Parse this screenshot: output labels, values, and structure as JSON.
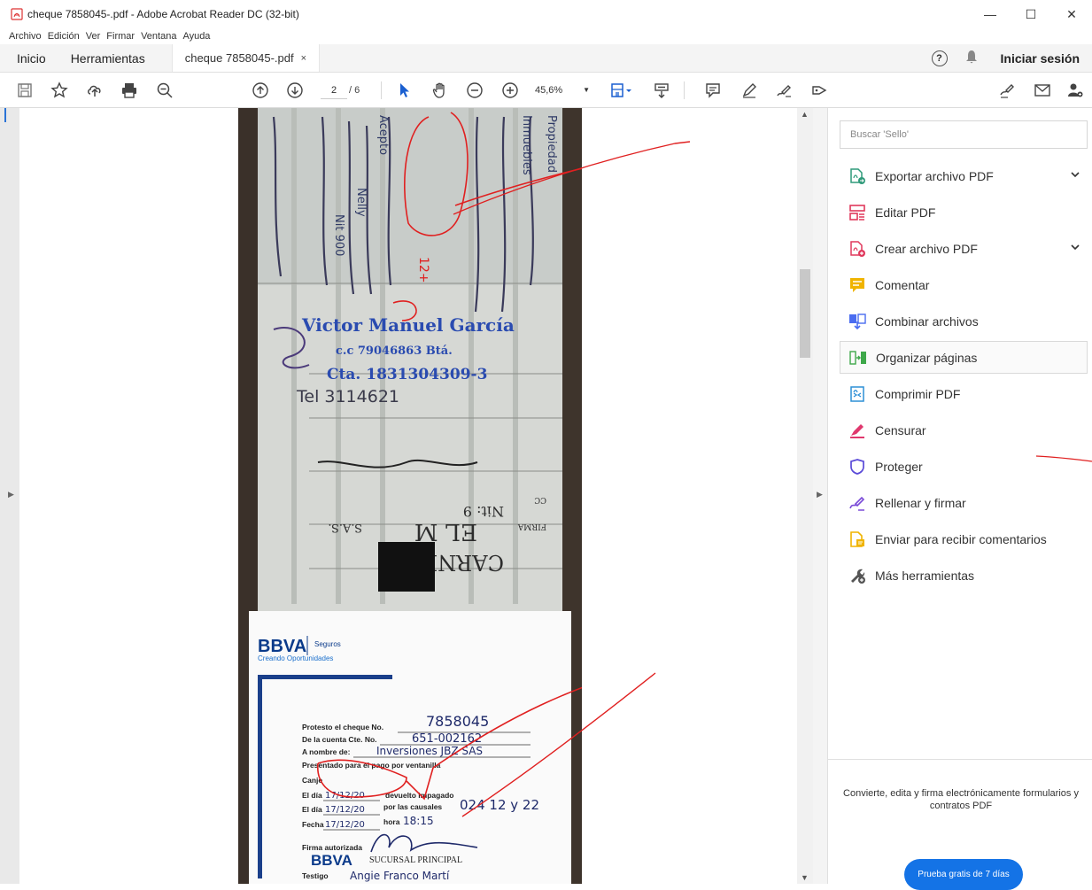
{
  "window": {
    "title": "cheque 7858045-.pdf - Adobe Acrobat Reader DC (32-bit)",
    "controls": {
      "minimize": "—",
      "maximize": "☐",
      "close": "✕"
    }
  },
  "menu": [
    "Archivo",
    "Edición",
    "Ver",
    "Firmar",
    "Ventana",
    "Ayuda"
  ],
  "tabs": {
    "home": "Inicio",
    "tools": "Herramientas",
    "document": "cheque 7858045-.pdf",
    "close": "×"
  },
  "header_right": {
    "help": "?",
    "signin": "Iniciar sesión"
  },
  "toolbar": {
    "current_page": "2",
    "total_pages": "/ 6",
    "zoom": "45,6%",
    "zoom_caret": "▼"
  },
  "panel": {
    "search_placeholder": "Buscar 'Sello'",
    "tools": [
      {
        "label": "Exportar archivo PDF",
        "icon": "export-pdf-icon",
        "color": "#2f9a7a",
        "expandable": true
      },
      {
        "label": "Editar PDF",
        "icon": "edit-pdf-icon",
        "color": "#e0385c"
      },
      {
        "label": "Crear archivo PDF",
        "icon": "create-pdf-icon",
        "color": "#e0385c",
        "expandable": true
      },
      {
        "label": "Comentar",
        "icon": "comment-icon",
        "color": "#f0b400"
      },
      {
        "label": "Combinar archivos",
        "icon": "combine-files-icon",
        "color": "#4a6cf0"
      },
      {
        "label": "Organizar páginas",
        "icon": "organize-pages-icon",
        "color": "#3ea84a",
        "selected": true
      },
      {
        "label": "Comprimir PDF",
        "icon": "compress-pdf-icon",
        "color": "#2d8fd6"
      },
      {
        "label": "Censurar",
        "icon": "redact-icon",
        "color": "#e0386e"
      },
      {
        "label": "Proteger",
        "icon": "protect-icon",
        "color": "#5a4ad8"
      },
      {
        "label": "Rellenar y firmar",
        "icon": "fill-sign-icon",
        "color": "#7a4ad8"
      },
      {
        "label": "Enviar para recibir comentarios",
        "icon": "send-review-icon",
        "color": "#f0b400"
      },
      {
        "label": "Más herramientas",
        "icon": "more-tools-icon",
        "color": "#555555"
      }
    ],
    "promo_text": "Convierte, edita y firma electrónicamente formularios y contratos PDF",
    "promo_button": "Prueba gratis de 7 días"
  },
  "document": {
    "handwritten_top": [
      "Propiedad",
      "Inmuebles",
      "Acepto",
      "Nelly",
      "Nit 900"
    ],
    "stamp_name": "Victor Manuel García",
    "stamp_cc": "c.c 79046863 Btá.",
    "stamp_account": "Cta. 1831304309-3",
    "stamp_tel": "Tel 3114621",
    "stub": {
      "cc": "CC",
      "firma": "FIRMA",
      "nit": "Nit: 9",
      "company_l1": "EL M",
      "company_l2": "CARNES",
      "sas": "S.A.S."
    },
    "bbva_logo": "BBVA",
    "bbva_seguros": "Seguros",
    "bbva_slogan": "Creando Oportunidades",
    "form": {
      "protesto_label": "Protesto el cheque No.",
      "protesto_value": "7858045",
      "cuenta_label": "De la cuenta Cte. No.",
      "cuenta_value": "651-002162",
      "nombre_label": "A nombre de:",
      "nombre_value": "Inversiones JBZ SAS",
      "presentado": "Presentado para el pago por ventanilla",
      "canje": "Canje",
      "dia1_label": "El día",
      "dia1_value": "17/12/20",
      "devuelto": "devuelto impagado",
      "dia2_label": "El día",
      "dia2_value": "17/12/20",
      "causales": "por las causales",
      "causales_value": "024 12 y 22",
      "fecha_label": "Fecha",
      "fecha_value": "17/12/20",
      "hora_label": "hora",
      "hora_value": "18:15",
      "firma_label": "Firma autorizada",
      "sucursal": "SUCURSAL PRINCIPAL",
      "testigo_label": "Testigo",
      "testigo_value": "Angie Franco Martí"
    }
  }
}
